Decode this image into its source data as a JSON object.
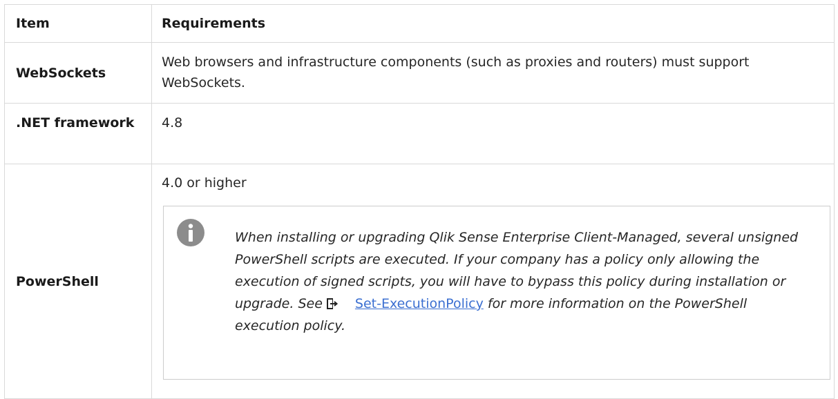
{
  "table": {
    "headers": {
      "item": "Item",
      "requirements": "Requirements"
    },
    "rows": {
      "websockets": {
        "item": "WebSockets",
        "requirement": "Web browsers and infrastructure components (such as proxies and routers) must support WebSockets."
      },
      "dotnet": {
        "item": ".NET framework",
        "requirement": "4.8"
      },
      "powershell": {
        "item": "PowerShell",
        "requirement": "4.0 or higher",
        "note": {
          "icon": "info-icon",
          "text_before_link": "When installing or upgrading Qlik Sense Enterprise Client-Managed, several unsigned PowerShell scripts are executed. If your company has a policy only allowing the execution of signed scripts, you will have to bypass this policy during installation or upgrade. See",
          "link_icon": "external-link-icon",
          "link_label": "Set-ExecutionPolicy",
          "text_after_link": " for more information on the PowerShell execution policy."
        }
      }
    }
  },
  "colors": {
    "border": "#d9d9d9",
    "link": "#3b6fd1",
    "info_icon": "#8c8c8c"
  }
}
